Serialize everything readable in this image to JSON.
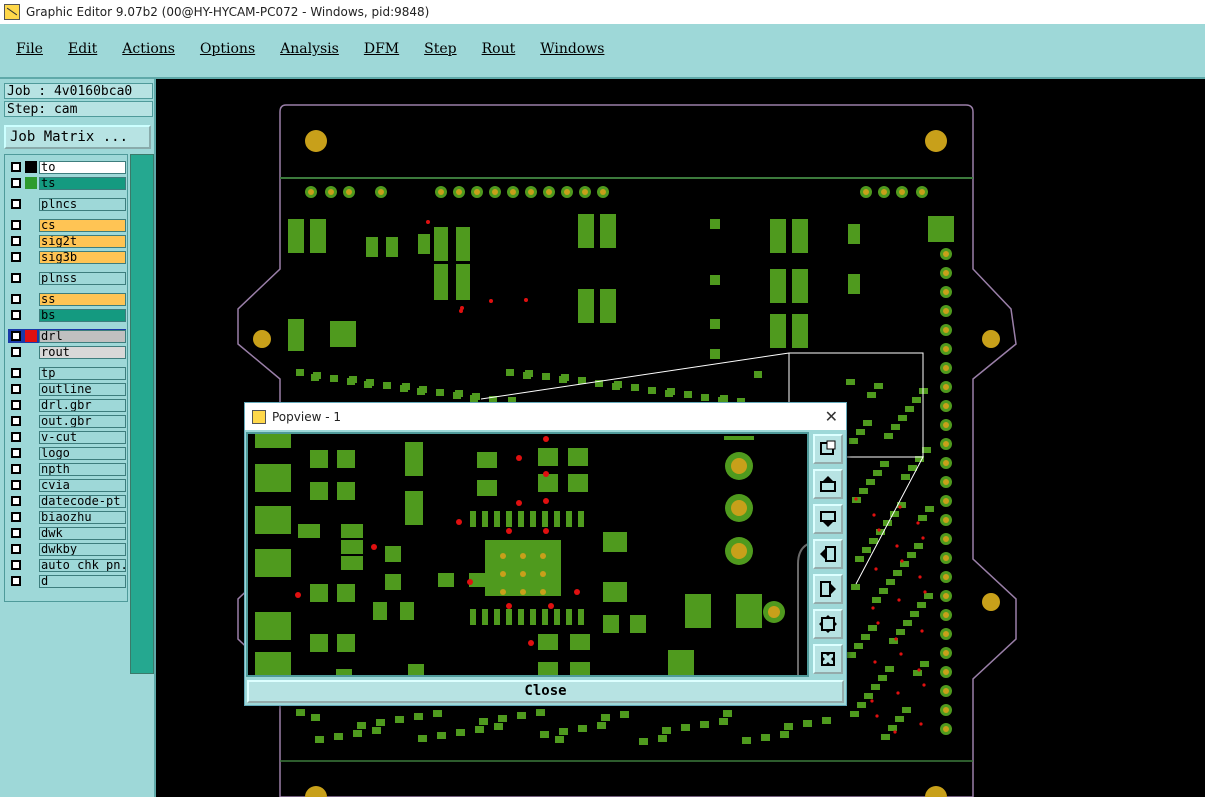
{
  "window": {
    "title": "Graphic Editor 9.07b2 (00@HY-HYCAM-PC072 - Windows, pid:9848)"
  },
  "menu": {
    "items": [
      "File",
      "Edit",
      "Actions",
      "Options",
      "Analysis",
      "DFM",
      "Step",
      "Rout",
      "Windows"
    ]
  },
  "info": {
    "job": "Job : 4v0160bca0",
    "step": "Step: cam",
    "job_matrix": "Job Matrix ..."
  },
  "layers": [
    {
      "name": "to",
      "color": "#ffffff",
      "swatch": "#000000"
    },
    {
      "name": "ts",
      "color": "#149a80",
      "swatch": "#2e9b2e"
    },
    {
      "name": "plncs",
      "color": "#9ed8d8",
      "swatch": ""
    },
    {
      "name": "cs",
      "color": "#ffc454",
      "swatch": ""
    },
    {
      "name": "sig2t",
      "color": "#ffc454",
      "swatch": ""
    },
    {
      "name": "sig3b",
      "color": "#ffc454",
      "swatch": ""
    },
    {
      "name": "plnss",
      "color": "#9ed8d8",
      "swatch": ""
    },
    {
      "name": "ss",
      "color": "#ffc454",
      "swatch": ""
    },
    {
      "name": "bs",
      "color": "#149a80",
      "swatch": ""
    },
    {
      "name": "drl",
      "color": "#c0c0c0",
      "swatch": "#e01010",
      "selected": true
    },
    {
      "name": "rout",
      "color": "#d8d8d8",
      "swatch": ""
    },
    {
      "name": "tp",
      "color": "#9ed8d8",
      "swatch": ""
    },
    {
      "name": "outline",
      "color": "#9ed8d8",
      "swatch": ""
    },
    {
      "name": "drl.gbr",
      "color": "#9ed8d8",
      "swatch": ""
    },
    {
      "name": "out.gbr",
      "color": "#9ed8d8",
      "swatch": ""
    },
    {
      "name": "v-cut",
      "color": "#9ed8d8",
      "swatch": ""
    },
    {
      "name": "logo",
      "color": "#9ed8d8",
      "swatch": ""
    },
    {
      "name": "npth",
      "color": "#9ed8d8",
      "swatch": ""
    },
    {
      "name": "cvia",
      "color": "#9ed8d8",
      "swatch": ""
    },
    {
      "name": "datecode-pt",
      "color": "#9ed8d8",
      "swatch": ""
    },
    {
      "name": "biaozhu",
      "color": "#9ed8d8",
      "swatch": ""
    },
    {
      "name": "dwk",
      "color": "#9ed8d8",
      "swatch": ""
    },
    {
      "name": "dwkby",
      "color": "#9ed8d8",
      "swatch": ""
    },
    {
      "name": "auto_chk_pn.",
      "color": "#9ed8d8",
      "swatch": ""
    },
    {
      "name": "d",
      "color": "#9ed8d8",
      "swatch": ""
    }
  ],
  "popview": {
    "title": "Popview - 1",
    "close_label": "Close"
  },
  "colors": {
    "panel": "#9ed8d8",
    "pad": "#4f9a1e",
    "via": "#c8a01a",
    "drill": "#e01010"
  }
}
